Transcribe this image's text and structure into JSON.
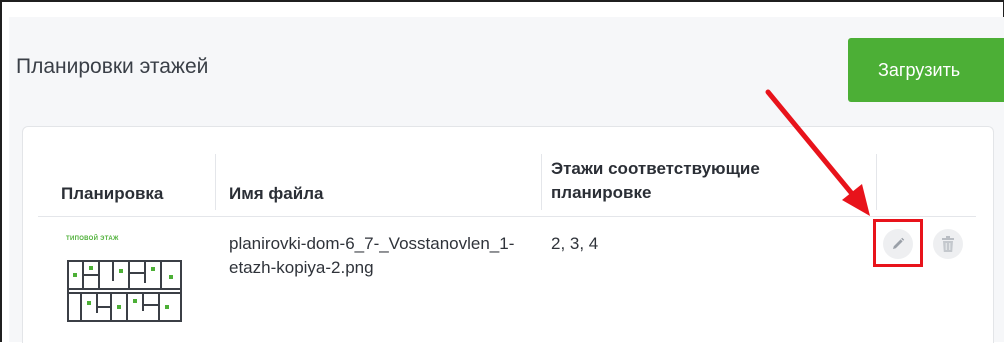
{
  "header": {
    "title": "Планировки этажей",
    "upload_label": "Загрузить"
  },
  "table": {
    "columns": [
      "Планировка",
      "Имя файла",
      "Этажи соответствующие планировке"
    ],
    "rows": [
      {
        "thumbnail_label": "ТИПОВОЙ ЭТАЖ",
        "file_name": "planirovki-dom-6_7-_Vosstanovlen_1-etazh-kopiya-2.png",
        "floors": "2, 3, 4"
      }
    ]
  },
  "icons": {
    "edit": "pencil-icon",
    "delete": "trash-icon"
  },
  "colors": {
    "accent": "#4caf36",
    "highlight": "#e8131b"
  }
}
